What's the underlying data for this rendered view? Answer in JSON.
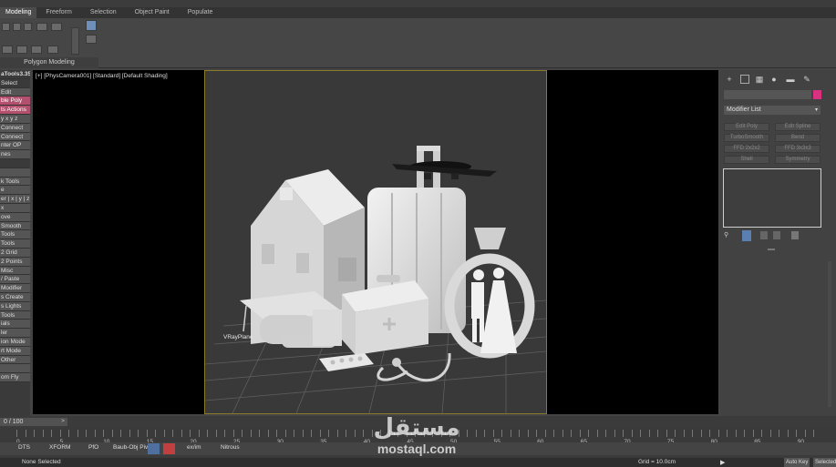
{
  "ribbon": {
    "tabs": [
      "Modeling",
      "Freeform",
      "Selection",
      "Object Paint",
      "Populate"
    ],
    "active_tab": "Modeling",
    "group_label": "Polygon Modeling"
  },
  "left_panel": {
    "title": "aTools3.35",
    "items": [
      {
        "label": "Select",
        "style": "plain"
      },
      {
        "label": "Edit",
        "style": "grey"
      },
      {
        "label": "ble Poly",
        "style": "pink"
      },
      {
        "label": "ts Actions",
        "style": "pink"
      },
      {
        "label": "y x y z",
        "style": "grey"
      },
      {
        "label": "Connect",
        "style": "grey"
      },
      {
        "label": "Connect",
        "style": "grey"
      },
      {
        "label": "nter OP",
        "style": "grey"
      },
      {
        "label": "nes",
        "style": "grey"
      },
      {
        "label": "",
        "style": "dark"
      },
      {
        "label": "",
        "style": "grey"
      },
      {
        "label": "k Tools",
        "style": "grey"
      },
      {
        "label": "e",
        "style": "grey"
      },
      {
        "label": "er | x | y | z",
        "style": "grey"
      },
      {
        "label": "x",
        "style": "grey"
      },
      {
        "label": "ove",
        "style": "grey"
      },
      {
        "label": "Smooth",
        "style": "grey"
      },
      {
        "label": "Tools",
        "style": "grey"
      },
      {
        "label": "Tools",
        "style": "grey"
      },
      {
        "label": "2 Grid",
        "style": "grey"
      },
      {
        "label": "2 Points",
        "style": "grey"
      },
      {
        "label": "Misc",
        "style": "grey"
      },
      {
        "label": "/ Paste",
        "style": "grey"
      },
      {
        "label": "Modifier",
        "style": "grey"
      },
      {
        "label": "s Create",
        "style": "grey"
      },
      {
        "label": "s Lights",
        "style": "grey"
      },
      {
        "label": "Tools",
        "style": "grey"
      },
      {
        "label": "ials",
        "style": "grey"
      },
      {
        "label": "ler",
        "style": "grey"
      },
      {
        "label": "ion Mode",
        "style": "grey"
      },
      {
        "label": "rt Mode",
        "style": "grey"
      },
      {
        "label": "Other",
        "style": "grey"
      },
      {
        "label": "",
        "style": "grey"
      },
      {
        "label": "om Fly",
        "style": "grey"
      }
    ]
  },
  "viewport": {
    "label": "[+] [PhysCamera001] [Standard] [Default Shading]",
    "object_label": "VRayPlane"
  },
  "right_panel": {
    "modifier_list": "Modifier List",
    "buttons": [
      "Edit Poly",
      "Edit Spline",
      "TurboSmooth",
      "Bend",
      "FFD 2x2x2",
      "FFD 3x3x3",
      "Shell",
      "Symmetry"
    ],
    "swatch_color": "#d9307f"
  },
  "timeline": {
    "frame": "0 / 100",
    "ticks": [
      "0",
      "5",
      "10",
      "15",
      "20",
      "25",
      "30",
      "35",
      "40",
      "45",
      "50",
      "55",
      "60",
      "65",
      "70",
      "75",
      "80",
      "85",
      "90"
    ]
  },
  "status": {
    "items": [
      "DTS",
      "XFORM",
      "PfO",
      "Baub-Obj Piv",
      "ex/im",
      "Nitrous"
    ],
    "selection": "None Selected",
    "grid": "Grid = 10.0cm",
    "auto_key": "Auto Key",
    "selected": "Selected"
  },
  "watermark": {
    "arabic": "مستقل",
    "latin": "mostaql.com"
  },
  "colors": {
    "accent": "#b2506e",
    "camera_border": "#8a7a2a",
    "viewport_bg": "#393939"
  }
}
